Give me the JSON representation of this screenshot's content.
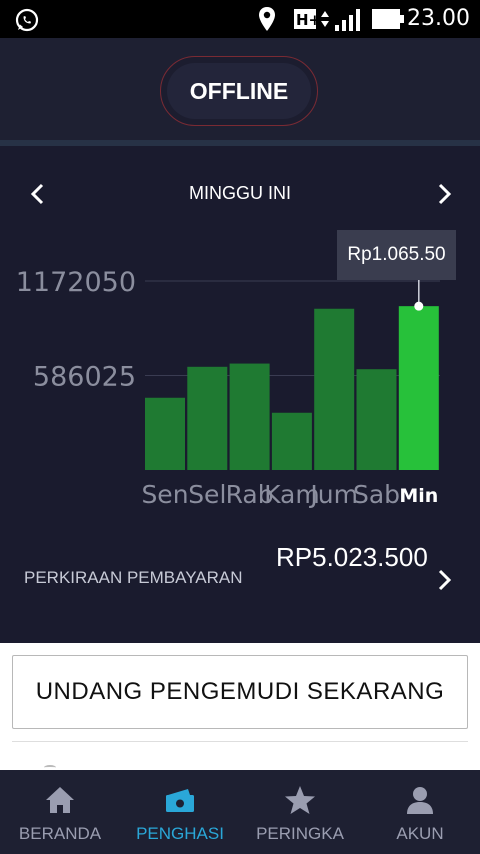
{
  "status_bar": {
    "time": "23.00",
    "network_label": "H+",
    "icons": [
      "whatsapp-icon",
      "location-icon",
      "network-type-icon",
      "signal-icon",
      "battery-icon"
    ]
  },
  "header": {
    "status_button_label": "OFFLINE"
  },
  "earnings": {
    "period_title": "MINGGU INI",
    "tooltip_value": "Rp1.065.50",
    "payout_label": "PERKIRAAN PEMBAYARAN",
    "payout_value": "RP5.023.500"
  },
  "chart_data": {
    "type": "bar",
    "categories": [
      "Sen",
      "Sel",
      "Rab",
      "Kam",
      "Jum",
      "Sab",
      "Min"
    ],
    "values": [
      448000,
      640000,
      660000,
      355000,
      1000000,
      625000,
      1016000
    ],
    "selected_index": 6,
    "y_ticks": [
      586025,
      1172050
    ],
    "y_tick_labels": [
      "586025",
      "1172050"
    ],
    "ylim": [
      0,
      1172050
    ],
    "colors": {
      "bar": "#1f7a32",
      "bar_selected": "#27c13a",
      "tick": "#8b8e9e",
      "selected_label": "#ffffff",
      "gridline": "#3a3c52"
    }
  },
  "invite": {
    "button_label": "UNDANG PENGEMUDI SEKARANG"
  },
  "bottom_nav": {
    "items": [
      {
        "label": "BERANDA",
        "icon": "home-icon"
      },
      {
        "label": "PENGHASI",
        "icon": "earnings-icon",
        "active": true
      },
      {
        "label": "PERINGKA",
        "icon": "star-icon"
      },
      {
        "label": "AKUN",
        "icon": "account-icon"
      }
    ],
    "active_color": "#2aa7d8"
  }
}
